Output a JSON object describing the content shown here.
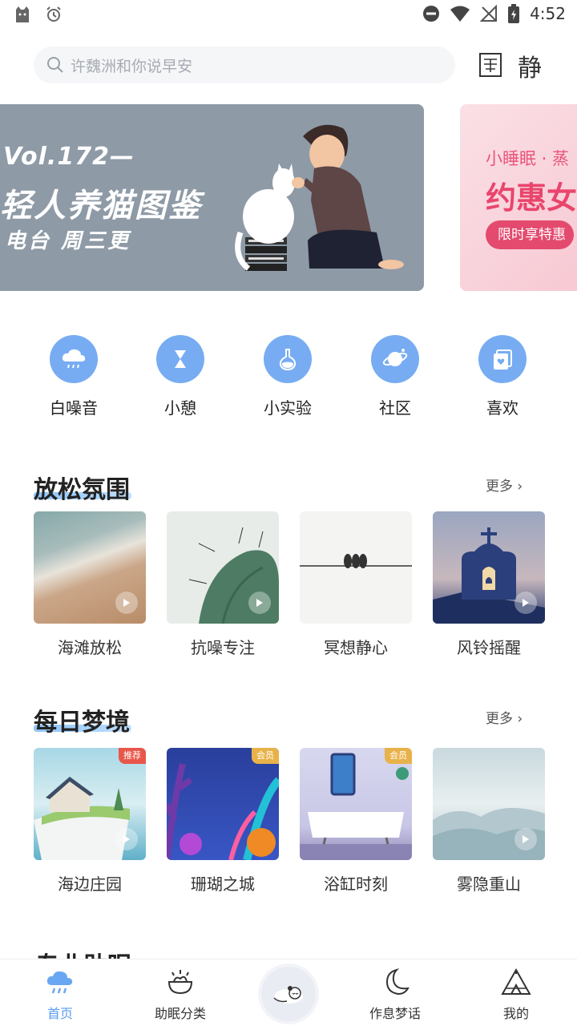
{
  "status_bar": {
    "time": "4:52",
    "icons": [
      "app-icon",
      "alarm-icon",
      "dnd-icon",
      "wifi-icon",
      "no-signal-icon",
      "battery-icon"
    ]
  },
  "search": {
    "placeholder": "许魏洲和你说早安"
  },
  "top_icons": {
    "quiet_label": "静"
  },
  "banner_main": {
    "vol": "Vol.172—",
    "title": "轻人养猫图鉴",
    "subtitle": "电台 周三更",
    "dots_total": 7,
    "dots_active": 6
  },
  "banner_side": {
    "line1": "小睡眠 · 蒸",
    "line2": "约惠女",
    "button": "限时享特惠"
  },
  "quick_categories": [
    {
      "label": "白噪音",
      "icon": "rain-cloud-icon"
    },
    {
      "label": "小憩",
      "icon": "hourglass-icon"
    },
    {
      "label": "小实验",
      "icon": "flask-icon"
    },
    {
      "label": "社区",
      "icon": "planet-icon"
    },
    {
      "label": "喜欢",
      "icon": "heart-card-icon"
    }
  ],
  "section_relax": {
    "title": "放松氛围",
    "more": "更多 ›",
    "items": [
      {
        "label": "海滩放松"
      },
      {
        "label": "抗噪专注"
      },
      {
        "label": "冥想静心"
      },
      {
        "label": "风铃摇醒"
      }
    ]
  },
  "section_dream": {
    "title": "每日梦境",
    "more": "更多 ›",
    "items": [
      {
        "label": "海边庄园",
        "tag": "推荐"
      },
      {
        "label": "珊瑚之城",
        "tag": "会员"
      },
      {
        "label": "浴缸时刻",
        "tag": "会员"
      },
      {
        "label": "雾隐重山",
        "tag": ""
      }
    ]
  },
  "section_partial": {
    "title": "专业助眠"
  },
  "bottom_nav": [
    {
      "label": "首页",
      "active": true
    },
    {
      "label": "助眠分类",
      "active": false
    },
    {
      "label": "",
      "active": false
    },
    {
      "label": "作息梦话",
      "active": false
    },
    {
      "label": "我的",
      "active": false
    }
  ],
  "colors": {
    "accent": "#5a9cf0",
    "icon_bg": "#77acf2",
    "banner_bg": "#8e9aa6",
    "promo_pink": "#e34a6e"
  }
}
